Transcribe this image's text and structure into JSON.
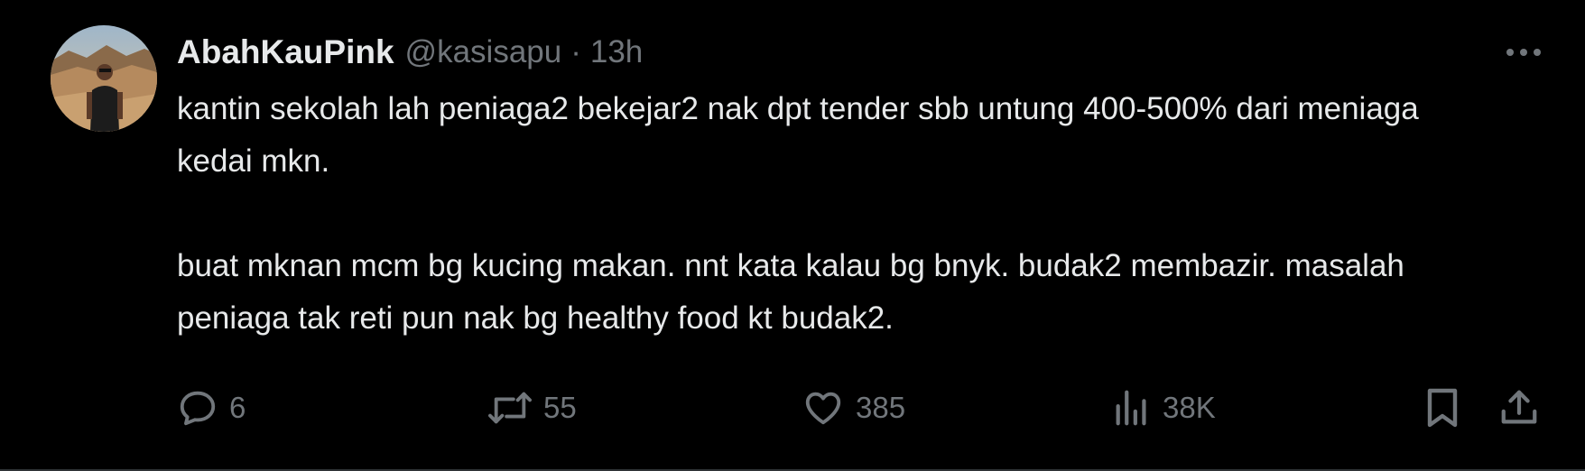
{
  "author": {
    "display_name": "AbahKauPink",
    "handle": "@kasisapu",
    "separator": "·",
    "time": "13h"
  },
  "tweet": {
    "paragraphs": [
      "kantin sekolah lah peniaga2 bekejar2 nak dpt tender sbb untung 400-500% dari meniaga kedai mkn.",
      "buat mknan mcm bg kucing makan. nnt kata kalau bg bnyk. budak2 membazir. masalah peniaga tak reti pun nak bg healthy food kt budak2."
    ]
  },
  "actions": {
    "reply": {
      "icon": "reply-icon",
      "count": "6"
    },
    "repost": {
      "icon": "repost-icon",
      "count": "55"
    },
    "like": {
      "icon": "heart-icon",
      "count": "385"
    },
    "views": {
      "icon": "views-icon",
      "count": "38K"
    },
    "bookmark": {
      "icon": "bookmark-icon"
    },
    "share": {
      "icon": "share-icon"
    }
  },
  "colors": {
    "background": "#000000",
    "text": "#e7e9ea",
    "secondary": "#71767b",
    "divider": "#2f3336"
  }
}
